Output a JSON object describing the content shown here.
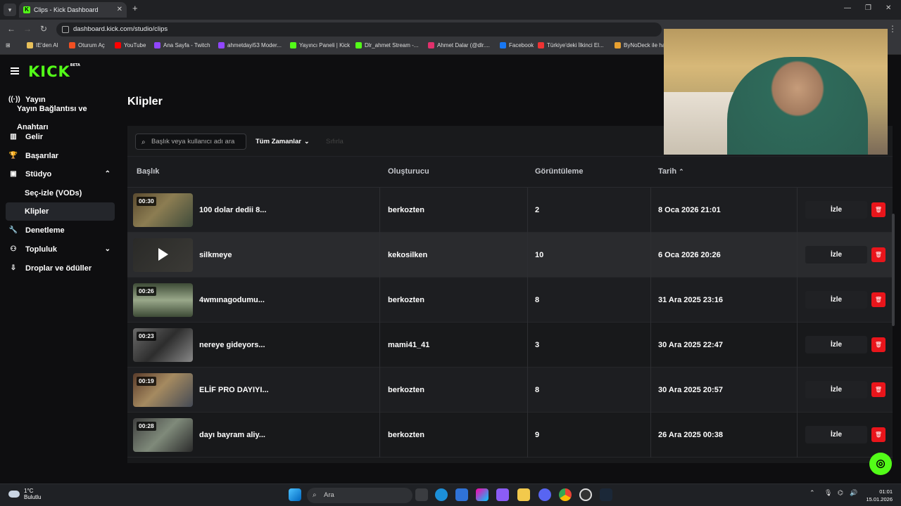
{
  "browser": {
    "tab_title": "Clips - Kick Dashboard",
    "url": "dashboard.kick.com/studio/clips",
    "bookmarks": [
      {
        "label": "IE'den Al",
        "color": "#e8c05a"
      },
      {
        "label": "Oturum Aç",
        "color": "#f25022"
      },
      {
        "label": "YouTube",
        "color": "#ff0000"
      },
      {
        "label": "Ana Sayfa - Twitch",
        "color": "#9146ff"
      },
      {
        "label": "ahmetdayi53 Moder...",
        "color": "#9146ff"
      },
      {
        "label": "Yayıncı Paneli | Kick",
        "color": "#53fc18"
      },
      {
        "label": "Dlr_ahmet Stream -...",
        "color": "#53fc18"
      },
      {
        "label": "Ahmet Dalar (@dlr....",
        "color": "#e1306c"
      },
      {
        "label": "Facebook",
        "color": "#1877f2"
      },
      {
        "label": "Türkiye'deki İlkinci El...",
        "color": "#e33"
      },
      {
        "label": "ByNoDeck ile ha",
        "color": "#e8a030"
      }
    ]
  },
  "sidebar": {
    "items": [
      {
        "label": "Yayın",
        "icon": "broadcast-icon"
      },
      {
        "label": "Yayın Bağlantısı ve Anahtarı",
        "icon": ""
      },
      {
        "label": "Gelir",
        "icon": "chart-icon"
      },
      {
        "label": "Başarılar",
        "icon": "trophy-icon"
      },
      {
        "label": "Stüdyo",
        "icon": "studio-icon"
      },
      {
        "label": "Seç-izle (VODs)",
        "icon": ""
      },
      {
        "label": "Klipler",
        "icon": ""
      },
      {
        "label": "Denetleme",
        "icon": "wrench-icon"
      },
      {
        "label": "Topluluk",
        "icon": "community-icon"
      },
      {
        "label": "Droplar ve ödüller",
        "icon": "drops-icon"
      }
    ]
  },
  "page": {
    "title": "Klipler",
    "search_placeholder": "Başlık veya kullanıcı adı ara",
    "filter_label": "Tüm Zamanlar",
    "filter_ghost": "Sıfırla"
  },
  "table": {
    "headers": [
      "Başlık",
      "Oluşturucu",
      "Görüntüleme",
      "Tarih"
    ],
    "watch_label": "İzle",
    "rows": [
      {
        "duration": "00:30",
        "title": "100 dolar dedii 8...",
        "creator": "berkozten",
        "views": "2",
        "date": "8 Oca 2026 21:01"
      },
      {
        "duration": "",
        "title": "silkmeye",
        "creator": "kekosilken",
        "views": "10",
        "date": "6 Oca 2026 20:26"
      },
      {
        "duration": "00:26",
        "title": "4wmınagodumu...",
        "creator": "berkozten",
        "views": "8",
        "date": "31 Ara 2025 23:16"
      },
      {
        "duration": "00:23",
        "title": "nereye gideyors...",
        "creator": "mami41_41",
        "views": "3",
        "date": "30 Ara 2025 22:47"
      },
      {
        "duration": "00:19",
        "title": "ELİF PRO DAYIYI...",
        "creator": "berkozten",
        "views": "8",
        "date": "30 Ara 2025 20:57"
      },
      {
        "duration": "00:28",
        "title": "dayı bayram aliy...",
        "creator": "berkozten",
        "views": "9",
        "date": "26 Ara 2025 00:38"
      }
    ]
  },
  "taskbar": {
    "temp": "1°C",
    "weather": "Bulutlu",
    "search_placeholder": "Ara",
    "time": "01:01",
    "date": "15.01.2026"
  },
  "colors": {
    "brand": "#53fc18",
    "delete": "#e9151b"
  }
}
